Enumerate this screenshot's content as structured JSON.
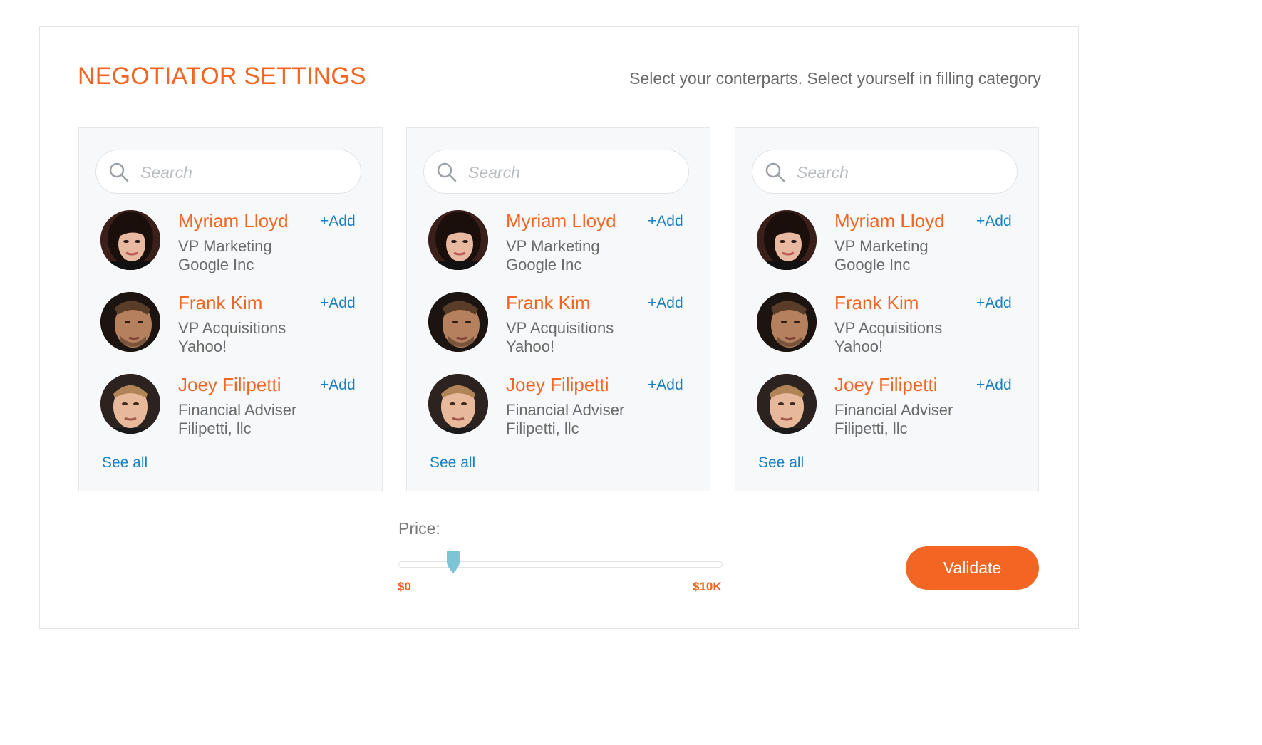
{
  "header": {
    "title": "NEGOTIATOR SETTINGS",
    "subtitle": "Select your conterparts. Select yourself in filling category"
  },
  "search_placeholder": "Search",
  "add_label": "+Add",
  "see_all_label": "See all",
  "people": [
    {
      "name": "Myriam Lloyd",
      "role": "VP Marketing",
      "company": "Google Inc"
    },
    {
      "name": "Frank Kim",
      "role": "VP Acquisitions",
      "company": "Yahoo!"
    },
    {
      "name": "Joey Filipetti",
      "role": "Financial Adviser",
      "company": "Filipetti, llc"
    }
  ],
  "price": {
    "label": "Price:",
    "min_label": "$0",
    "max_label": "$10K",
    "value_fraction": 0.17
  },
  "validate_label": "Validate",
  "colors": {
    "accent": "#f26522",
    "link": "#1a7fc1",
    "slider_handle": "#7cc4d6"
  }
}
